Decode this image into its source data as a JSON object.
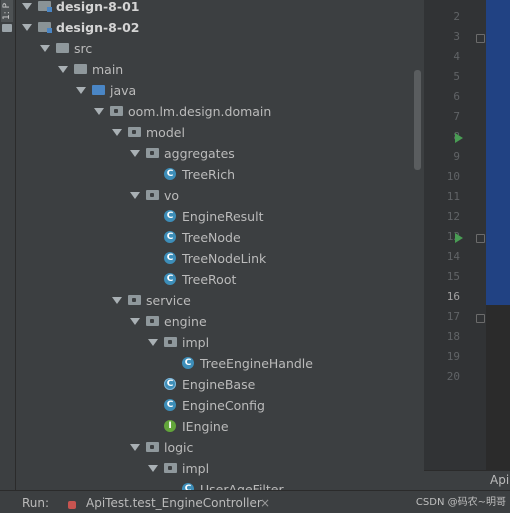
{
  "left_strip": {
    "label": "1: P"
  },
  "project_tree": {
    "rows": [
      {
        "label": "design-8-01",
        "kind": "module",
        "depth": 1,
        "expanded": true,
        "bold": true
      },
      {
        "label": "design-8-02",
        "kind": "module",
        "depth": 1,
        "expanded": true,
        "bold": true
      },
      {
        "label": "src",
        "kind": "folder",
        "depth": 2,
        "expanded": true
      },
      {
        "label": "main",
        "kind": "folder",
        "depth": 3,
        "expanded": true
      },
      {
        "label": "java",
        "kind": "java-folder",
        "depth": 4,
        "expanded": true
      },
      {
        "label": "oom.lm.design.domain",
        "kind": "package",
        "depth": 5,
        "expanded": true
      },
      {
        "label": "model",
        "kind": "package",
        "depth": 6,
        "expanded": true
      },
      {
        "label": "aggregates",
        "kind": "package",
        "depth": 7,
        "expanded": true
      },
      {
        "label": "TreeRich",
        "kind": "class",
        "depth": 8
      },
      {
        "label": "vo",
        "kind": "package",
        "depth": 7,
        "expanded": true
      },
      {
        "label": "EngineResult",
        "kind": "class",
        "depth": 8
      },
      {
        "label": "TreeNode",
        "kind": "class",
        "depth": 8
      },
      {
        "label": "TreeNodeLink",
        "kind": "class",
        "depth": 8
      },
      {
        "label": "TreeRoot",
        "kind": "class",
        "depth": 8
      },
      {
        "label": "service",
        "kind": "package",
        "depth": 6,
        "expanded": true
      },
      {
        "label": "engine",
        "kind": "package",
        "depth": 7,
        "expanded": true
      },
      {
        "label": "impl",
        "kind": "package",
        "depth": 8,
        "expanded": true
      },
      {
        "label": "TreeEngineHandle",
        "kind": "class",
        "depth": 9
      },
      {
        "label": "EngineBase",
        "kind": "abstract-class",
        "depth": 8
      },
      {
        "label": "EngineConfig",
        "kind": "class",
        "depth": 8
      },
      {
        "label": "IEngine",
        "kind": "interface",
        "depth": 8
      },
      {
        "label": "logic",
        "kind": "package",
        "depth": 7,
        "expanded": true
      },
      {
        "label": "impl",
        "kind": "package",
        "depth": 8,
        "expanded": true
      },
      {
        "label": "UserAgeFilter",
        "kind": "class",
        "depth": 9
      }
    ]
  },
  "editor": {
    "line_numbers": [
      "2",
      "3",
      "4",
      "5",
      "6",
      "7",
      "8",
      "9",
      "10",
      "11",
      "12",
      "13",
      "14",
      "15",
      "16",
      "17",
      "18",
      "19",
      "20"
    ],
    "current_line": "16",
    "run_markers": [
      "8",
      "13"
    ],
    "fold_markers": [
      "3",
      "13",
      "17"
    ],
    "tab_label": "Api"
  },
  "run_bar": {
    "label": "Run:",
    "config": "ApiTest.test_EngineController",
    "close": "×"
  },
  "watermark": "CSDN @码农~明哥",
  "colors": {
    "panel_bg": "#3c3f41",
    "gutter_bg": "#313335",
    "selection_bg": "#214283",
    "class_icon": "#3d8eb9",
    "interface_icon": "#62a53a",
    "run_icon": "#499c54"
  }
}
